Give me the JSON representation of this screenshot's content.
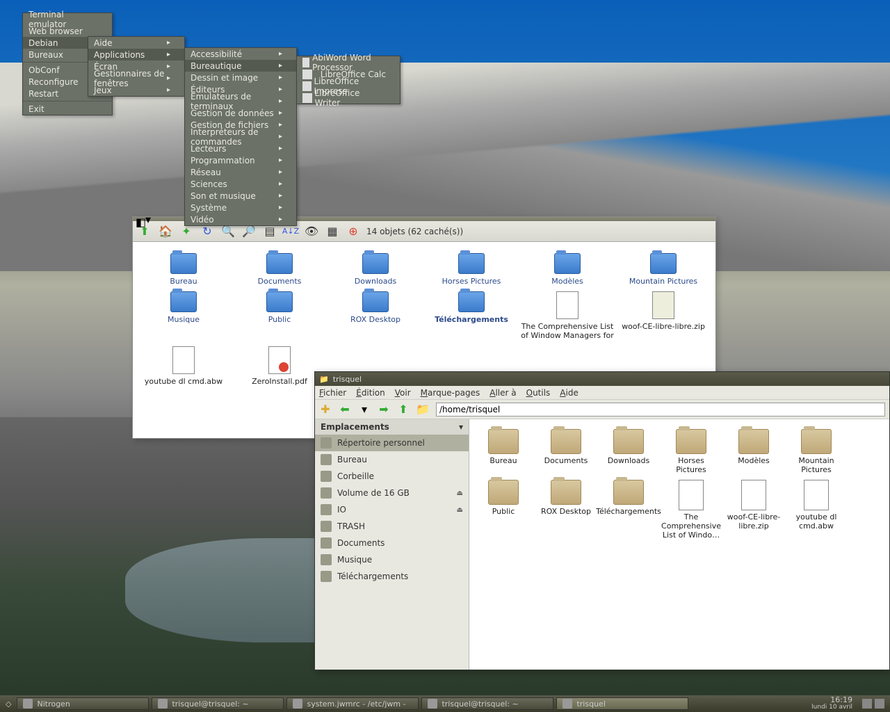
{
  "menu0": {
    "items": [
      "Terminal emulator",
      "Web browser",
      "Debian",
      "Bureaux",
      "",
      "ObConf",
      "Reconfigure",
      "Restart",
      "",
      "Exit"
    ],
    "subs": [
      false,
      false,
      true,
      true,
      "sep",
      false,
      false,
      false,
      "sep",
      false
    ],
    "highlight": 2
  },
  "menu1": {
    "items": [
      "Aide",
      "Applications",
      "Écran",
      "Gestionnaires de fenêtres",
      "Jeux"
    ],
    "subs": [
      true,
      true,
      true,
      true,
      true
    ],
    "highlight": 1
  },
  "menu2": {
    "items": [
      "Accessibilité",
      "Bureautique",
      "Dessin et image",
      "Éditeurs",
      "Émulateurs de terminaux",
      "Gestion de données",
      "Gestion de fichiers",
      "Interpréteurs de commandes",
      "Lecteurs",
      "Programmation",
      "Réseau",
      "Sciences",
      "Son et musique",
      "Système",
      "Vidéo"
    ],
    "subs": [
      true,
      true,
      true,
      true,
      true,
      true,
      true,
      true,
      true,
      true,
      true,
      true,
      true,
      true,
      true
    ],
    "highlight": 1
  },
  "menu3": {
    "items": [
      "AbiWord Word Processor",
      "LibreOffice Calc",
      "LibreOffice Impress",
      "LibreOffice Writer"
    ]
  },
  "rox": {
    "status": "14 objets (62 caché(s))",
    "items": [
      {
        "name": "Bureau",
        "type": "folder"
      },
      {
        "name": "Documents",
        "type": "folder"
      },
      {
        "name": "Downloads",
        "type": "folder"
      },
      {
        "name": "Horses Pictures",
        "type": "folder"
      },
      {
        "name": "Modèles",
        "type": "folder"
      },
      {
        "name": "Mountain Pictures",
        "type": "folder"
      },
      {
        "name": "Musique",
        "type": "folder"
      },
      {
        "name": "Public",
        "type": "folder"
      },
      {
        "name": "ROX Desktop",
        "type": "folder"
      },
      {
        "name": "Téléchargements",
        "type": "folder",
        "bold": true
      },
      {
        "name": "The Comprehensive List of Window Managers for",
        "type": "file",
        "black": true
      },
      {
        "name": "woof-CE-libre-libre.zip",
        "type": "zip",
        "black": true
      },
      {
        "name": "youtube dl cmd.abw",
        "type": "file",
        "black": true
      },
      {
        "name": "ZeroInstall.pdf",
        "type": "pdf",
        "black": true
      }
    ]
  },
  "pcman": {
    "title": "trisquel",
    "menus": [
      "Fichier",
      "Édition",
      "Voir",
      "Marque-pages",
      "Aller à",
      "Outils",
      "Aide"
    ],
    "path": "/home/trisquel",
    "sidebar_header": "Emplacements",
    "sidebar": [
      {
        "name": "Répertoire personnel",
        "selected": true
      },
      {
        "name": "Bureau"
      },
      {
        "name": "Corbeille"
      },
      {
        "name": "Volume de 16 GB",
        "eject": true
      },
      {
        "name": "IO",
        "eject": true
      },
      {
        "name": "TRASH"
      },
      {
        "name": "Documents"
      },
      {
        "name": "Musique"
      },
      {
        "name": "Téléchargements"
      }
    ],
    "files": [
      {
        "name": "Bureau",
        "type": "folder"
      },
      {
        "name": "Documents",
        "type": "folder"
      },
      {
        "name": "Downloads",
        "type": "folder"
      },
      {
        "name": "Horses Pictures",
        "type": "folder"
      },
      {
        "name": "Modèles",
        "type": "folder"
      },
      {
        "name": "Mountain Pictures",
        "type": "folder"
      },
      {
        "name": "Public",
        "type": "folder"
      },
      {
        "name": "ROX Desktop",
        "type": "folder"
      },
      {
        "name": "Téléchargements",
        "type": "folder"
      },
      {
        "name": "The Comprehensive List of Windo…",
        "type": "file"
      },
      {
        "name": "woof-CE-libre-libre.zip",
        "type": "zip"
      },
      {
        "name": "youtube dl cmd.abw",
        "type": "file"
      }
    ]
  },
  "taskbar": {
    "items": [
      {
        "label": "Nitrogen"
      },
      {
        "label": "trisquel@trisquel: ~"
      },
      {
        "label": "system.jwmrc - /etc/jwm -"
      },
      {
        "label": "trisquel@trisquel: ~"
      },
      {
        "label": "trisquel",
        "active": true
      }
    ],
    "time": "16:19",
    "date": "lundi 10 avril"
  }
}
